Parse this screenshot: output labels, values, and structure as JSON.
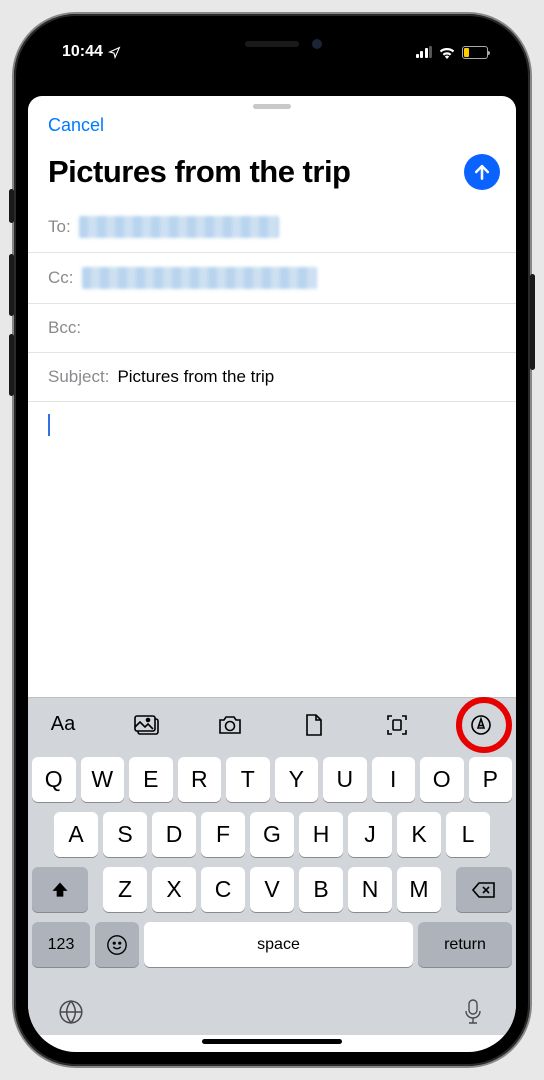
{
  "status": {
    "time": "10:44",
    "location_icon": "location-arrow"
  },
  "sheet": {
    "cancel": "Cancel",
    "title": "Pictures from the trip",
    "fields": {
      "to_label": "To:",
      "cc_label": "Cc:",
      "bcc_label": "Bcc:",
      "subject_label": "Subject:",
      "subject_value": "Pictures from the trip"
    }
  },
  "accessory": {
    "icons": [
      "text-format",
      "photos",
      "camera",
      "document",
      "scan",
      "markup"
    ]
  },
  "keyboard": {
    "row1": [
      "Q",
      "W",
      "E",
      "R",
      "T",
      "Y",
      "U",
      "I",
      "O",
      "P"
    ],
    "row2": [
      "A",
      "S",
      "D",
      "F",
      "G",
      "H",
      "J",
      "K",
      "L"
    ],
    "row3": [
      "Z",
      "X",
      "C",
      "V",
      "B",
      "N",
      "M"
    ],
    "numeric": "123",
    "space": "space",
    "return": "return"
  }
}
